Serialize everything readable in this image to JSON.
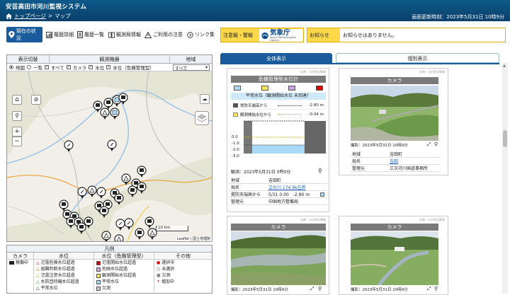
{
  "header": {
    "title": "安芸高田市河川監視システム",
    "breadcrumb_top": "トップページ",
    "breadcrumb_sep": ">",
    "breadcrumb_current": "マップ",
    "update_label": "画面更新時刻：2023年5月31日 10時9分"
  },
  "nav": {
    "items": [
      {
        "label": "現在の状況",
        "icon": "location-pin-icon"
      },
      {
        "label": "履歴詳細",
        "icon": "chart-icon"
      },
      {
        "label": "履歴一覧",
        "icon": "document-icon"
      },
      {
        "label": "観測局情報",
        "icon": "book-icon"
      },
      {
        "label": "ご利用の注意",
        "icon": "warning-icon"
      },
      {
        "label": "リンク集",
        "icon": "link-icon"
      }
    ],
    "warning_label": "注意報・警報",
    "jma_name": "気象庁",
    "jma_sub": "Japan Meteorological Agency",
    "notice_label": "お知らせ",
    "notice_message": "お知らせはありません。"
  },
  "filter": {
    "headers": [
      "表示切替",
      "観測機器",
      "地域"
    ],
    "map_label": "地図",
    "list_label": "一覧",
    "all_label": "すべて",
    "camera_label": "カメラ",
    "water_label": "水位",
    "crisis_label": "水位（危機管理型）",
    "region_value": "すべて"
  },
  "map": {
    "scale": "10 km",
    "attribution": "Leaflet | 国土地理院",
    "zoom_in": "+",
    "zoom_out": "−"
  },
  "legend": {
    "title": "凡例",
    "headers": [
      "カメラ",
      "水位",
      "水位（危機管理型）",
      "その他"
    ],
    "camera": [
      "稼働中"
    ],
    "water": [
      "氾濫危険水位超過",
      "避難判断水位超過",
      "氾濫注意水位超過",
      "水防団待機水位超過",
      "平常水位"
    ],
    "crisis": [
      "氾濫開始水位超過",
      "危険水位超過",
      "観測開始水位超過",
      "平常水位",
      "欠測"
    ],
    "other": [
      "選択中",
      "未選択",
      "欠測",
      "増加中"
    ]
  },
  "tabs": {
    "all": "全体表示",
    "individual": "個別表示"
  },
  "cards": {
    "source_note": "出典：川の防災情報",
    "gauge": {
      "title": "危機管理型水位計",
      "status": "平常水位（観測開始水位 未到達）",
      "row1_label": "堤防天端高から",
      "row1_value": "-2.80 m",
      "row2_label": "観測開始水位から",
      "row2_value": "-0.04 m",
      "axis": [
        "0.0",
        "-1.0",
        "-2.0",
        "-3.0"
      ],
      "observed": "観測：2023年5月31日 0時0分",
      "info": [
        {
          "k": "地域",
          "v": "吉田町"
        },
        {
          "k": "局名",
          "v": "江の川 174.9k左岸"
        },
        {
          "k": "堤防天端高から",
          "v": "5/31 0:00　-2.80 m"
        },
        {
          "k": "管理元",
          "v": "中国地方整備局"
        }
      ]
    },
    "camera1": {
      "title": "カメラ",
      "shot": "撮影：2023年5月31日 10時9分",
      "info": [
        {
          "k": "地域",
          "v": "吉田町"
        },
        {
          "k": "局名",
          "v": "吉田"
        },
        {
          "k": "管理元",
          "v": "三次河川国道事務所"
        }
      ]
    },
    "camera2": {
      "title": "カメラ",
      "shot": "撮影：2023年5月31日 10時9分"
    },
    "camera3": {
      "title": "カメラ",
      "shot": "撮影：2023年5月31日 10時9分"
    }
  },
  "colors": {
    "header": "#0d5a8a",
    "accent": "#1a5c9b",
    "warning": "#ffd84a"
  }
}
